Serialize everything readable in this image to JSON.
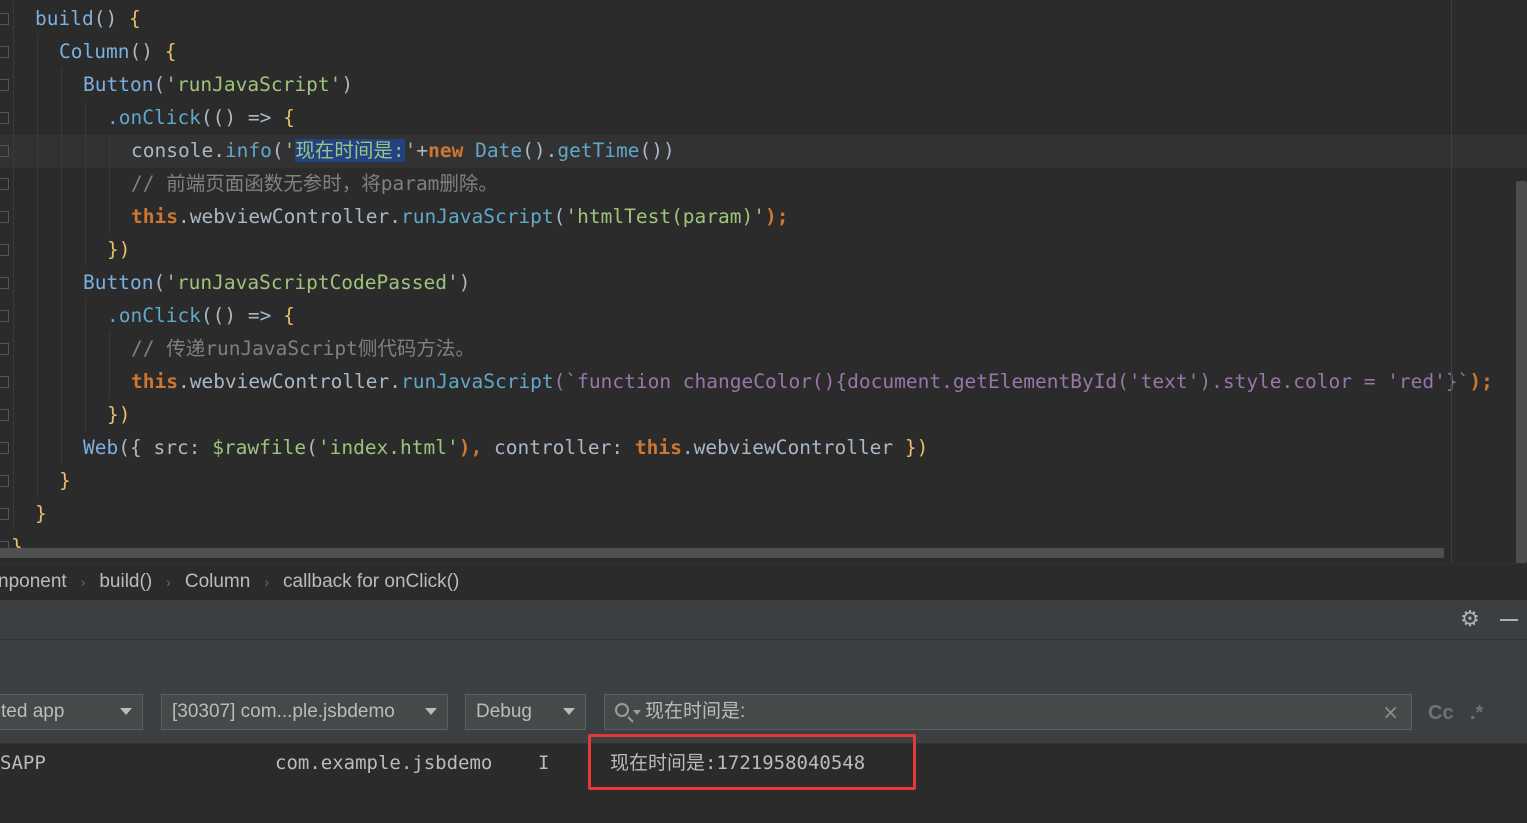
{
  "editor": {
    "lines": [
      [
        {
          "t": "build",
          "c": "k-fn"
        },
        {
          "t": "() ",
          "c": "k-pl"
        },
        {
          "t": "{",
          "c": "k-brace"
        }
      ],
      [
        {
          "t": "Column",
          "c": "k-fn"
        },
        {
          "t": "() ",
          "c": "k-pl"
        },
        {
          "t": "{",
          "c": "k-brace"
        }
      ],
      [
        {
          "t": "Button",
          "c": "k-fn"
        },
        {
          "t": "(",
          "c": "k-pl"
        },
        {
          "t": "'runJavaScript'",
          "c": "k-str2"
        },
        {
          "t": ")",
          "c": "k-pl"
        }
      ],
      [
        {
          "t": ".onClick",
          "c": "k-method"
        },
        {
          "t": "(() => ",
          "c": "k-pl"
        },
        {
          "t": "{",
          "c": "k-brace"
        }
      ],
      [
        {
          "t": "console",
          "c": "k-pl"
        },
        {
          "t": ".",
          "c": "k-pl"
        },
        {
          "t": "info",
          "c": "k-method"
        },
        {
          "t": "(",
          "c": "k-pl"
        },
        {
          "t": "'",
          "c": "k-str2"
        },
        {
          "t": "现在时间是:",
          "c": "k-str2 k-sel"
        },
        {
          "t": "'",
          "c": "k-str2"
        },
        {
          "t": "+",
          "c": "k-pl"
        },
        {
          "t": "new ",
          "c": "k-kw"
        },
        {
          "t": "Date",
          "c": "k-method"
        },
        {
          "t": "().",
          "c": "k-pl"
        },
        {
          "t": "getTime",
          "c": "k-method"
        },
        {
          "t": "())",
          "c": "k-pl"
        }
      ],
      [
        {
          "t": "// 前端页面函数无参时，将param删除。",
          "c": "k-cm"
        }
      ],
      [
        {
          "t": "this",
          "c": "k-this"
        },
        {
          "t": ".webviewController.",
          "c": "k-pl"
        },
        {
          "t": "runJavaScript",
          "c": "k-method"
        },
        {
          "t": "(",
          "c": "k-pl"
        },
        {
          "t": "'htmlTest(param)'",
          "c": "k-str2"
        },
        {
          "t": ");",
          "c": "k-kw"
        }
      ],
      [
        {
          "t": "})",
          "c": "k-brace"
        }
      ],
      [
        {
          "t": "Button",
          "c": "k-fn"
        },
        {
          "t": "(",
          "c": "k-pl"
        },
        {
          "t": "'runJavaScriptCodePassed'",
          "c": "k-str2"
        },
        {
          "t": ")",
          "c": "k-pl"
        }
      ],
      [
        {
          "t": ".onClick",
          "c": "k-method"
        },
        {
          "t": "(() => ",
          "c": "k-pl"
        },
        {
          "t": "{",
          "c": "k-brace"
        }
      ],
      [
        {
          "t": "// 传递runJavaScript侧代码方法。",
          "c": "k-cm"
        }
      ],
      [
        {
          "t": "this",
          "c": "k-this"
        },
        {
          "t": ".webviewController.",
          "c": "k-pl"
        },
        {
          "t": "runJavaScript",
          "c": "k-method"
        },
        {
          "t": "(`function changeColor(){document.getElementById('text').style.color = 'red'}`",
          "c": "k-tpl"
        },
        {
          "t": ");",
          "c": "k-kw"
        }
      ],
      [
        {
          "t": "})",
          "c": "k-brace"
        }
      ],
      [
        {
          "t": "Web",
          "c": "k-fn"
        },
        {
          "t": "({ ",
          "c": "k-pl"
        },
        {
          "t": "src",
          "c": "k-pl"
        },
        {
          "t": ": ",
          "c": "k-pl"
        },
        {
          "t": "$rawfile",
          "c": "k-str2"
        },
        {
          "t": "(",
          "c": "k-pl"
        },
        {
          "t": "'index.html'",
          "c": "k-str2"
        },
        {
          "t": "), ",
          "c": "k-kw"
        },
        {
          "t": "controller",
          "c": "k-pl"
        },
        {
          "t": ": ",
          "c": "k-pl"
        },
        {
          "t": "this",
          "c": "k-this"
        },
        {
          "t": ".webviewController ",
          "c": "k-pl"
        },
        {
          "t": "})",
          "c": "k-brace"
        }
      ],
      [
        {
          "t": "}",
          "c": "k-brace"
        }
      ],
      [
        {
          "t": "}",
          "c": "k-brace"
        }
      ],
      [
        {
          "t": "}",
          "c": "k-brace"
        }
      ]
    ],
    "indents": [
      1,
      2,
      3,
      4,
      5,
      5,
      5,
      4,
      3,
      4,
      5,
      5,
      4,
      3,
      2,
      1,
      0
    ]
  },
  "breadcrumb": {
    "items": [
      "nponent",
      "build()",
      "Column",
      "callback for onClick()"
    ],
    "separator": "›"
  },
  "toolbar": {
    "settings_icon": "gear-icon",
    "minimize_icon": "minimize-icon"
  },
  "filters": {
    "app_select": "ted app",
    "process_select": "[30307] com...ple.jsbdemo",
    "level_select": "Debug",
    "search_value": "现在时间是:",
    "match_case_label": "Cc",
    "regex_label": ".*"
  },
  "log": {
    "tag": "SAPP",
    "package": "com.example.jsbdemo",
    "level": "I",
    "message": "现在时间是:1721958040548"
  },
  "colors": {
    "highlight_box": "#e53935",
    "editor_bg": "#2b2b2b",
    "panel_bg": "#3c3f41"
  }
}
